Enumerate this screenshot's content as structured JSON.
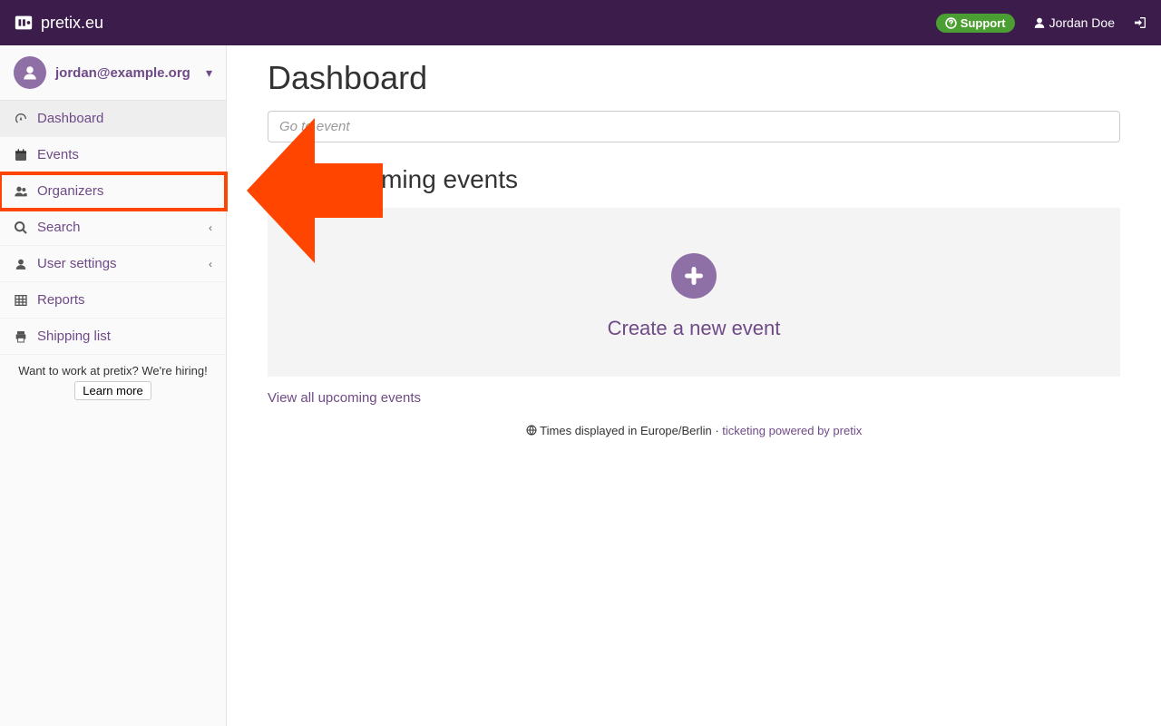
{
  "topbar": {
    "brand": "pretix.eu",
    "support": "Support",
    "user_name": "Jordan Doe"
  },
  "sidebar": {
    "account_email": "jordan@example.org",
    "items": {
      "dashboard": "Dashboard",
      "events": "Events",
      "organizers": "Organizers",
      "search": "Search",
      "user_settings": "User settings",
      "reports": "Reports",
      "shipping_list": "Shipping list"
    },
    "hiring_text": "Want to work at pretix? We're hiring!",
    "hiring_button": "Learn more"
  },
  "main": {
    "title": "Dashboard",
    "go_placeholder": "Go to event",
    "upcoming_heading": "Your upcoming events",
    "create_event": "Create a new event",
    "view_all": "View all upcoming events",
    "footer_tz": "Times displayed in Europe/Berlin",
    "footer_sep": " · ",
    "footer_link": "ticketing powered by pretix"
  }
}
